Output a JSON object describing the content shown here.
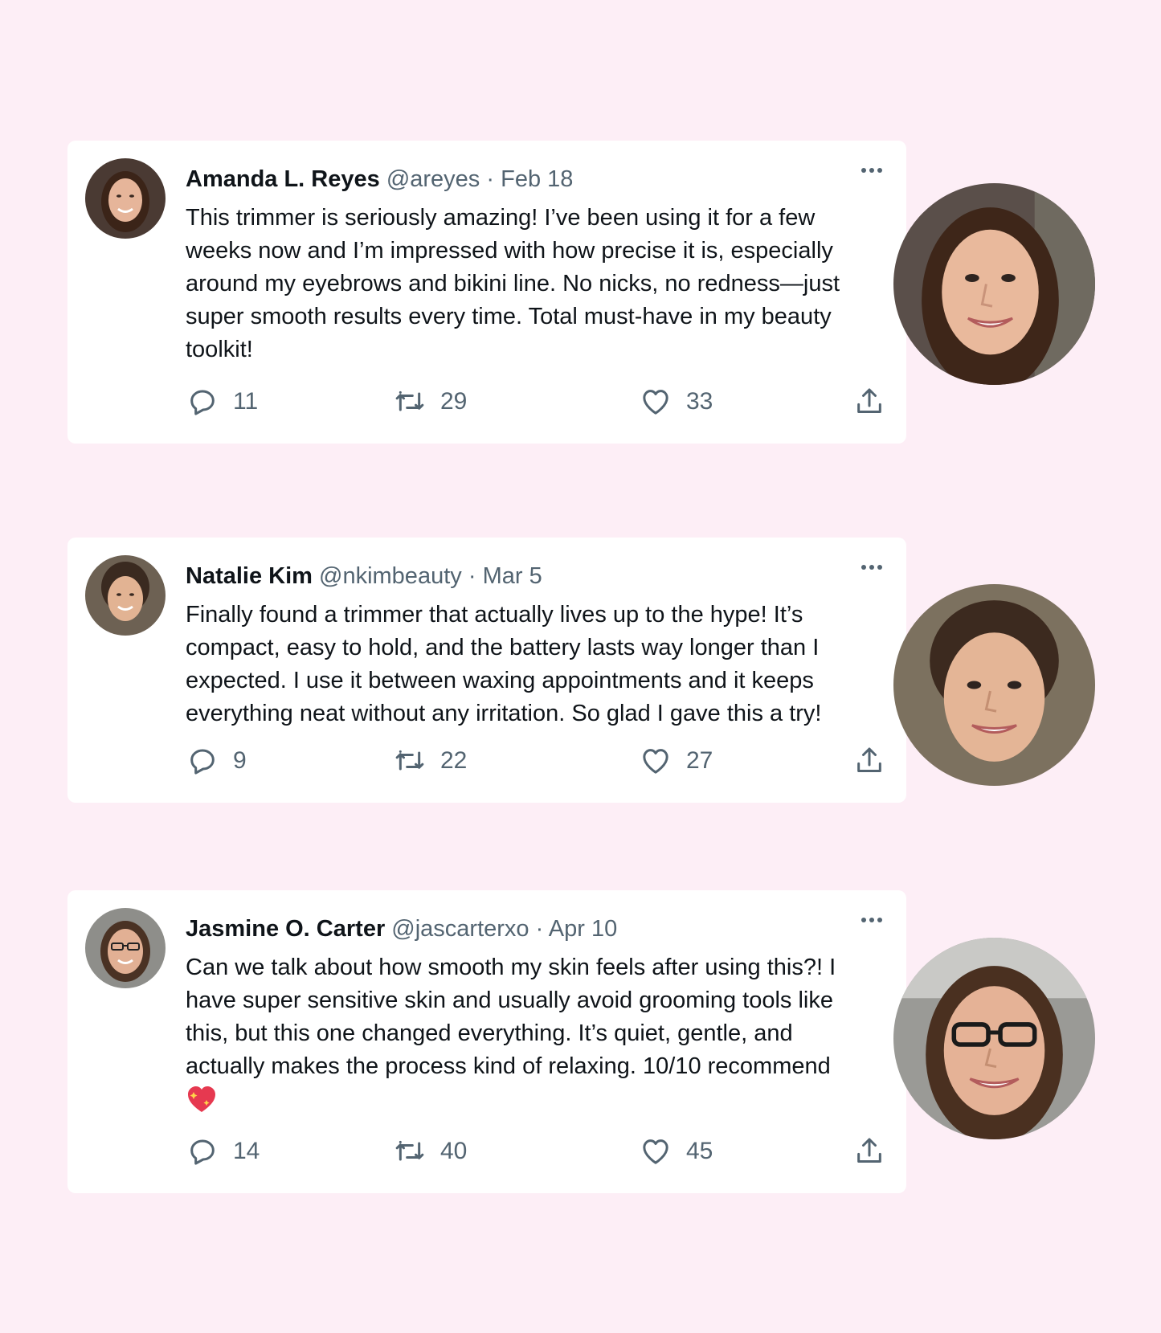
{
  "colors": {
    "background": "#fdeef6",
    "card": "#ffffff",
    "text": "#0f1419",
    "muted": "#536471"
  },
  "tweets": [
    {
      "name": "Amanda L. Reyes",
      "handle": "@areyes",
      "separator": "·",
      "date": "Feb 18",
      "text": "This trimmer is seriously amazing! I’ve been using it for a few weeks now and I’m impressed with how precise it is, especially around my eyebrows and bikini line. No nicks, no redness—just super smooth results every time. Total must-have in my beauty toolkit!",
      "replies": "11",
      "retweets": "29",
      "likes": "33",
      "icons": [
        "reply-icon",
        "retweet-icon",
        "heart-icon",
        "share-icon",
        "more-icon"
      ]
    },
    {
      "name": "Natalie Kim",
      "handle": "@nkimbeauty",
      "separator": "·",
      "date": "Mar 5",
      "text": "Finally found a trimmer that actually lives up to the hype! It’s compact, easy to hold, and the battery lasts way longer than I expected. I use it between waxing appointments and it keeps everything neat without any irritation. So glad I gave this a try!",
      "replies": "9",
      "retweets": "22",
      "likes": "27",
      "icons": [
        "reply-icon",
        "retweet-icon",
        "heart-icon",
        "share-icon",
        "more-icon"
      ]
    },
    {
      "name": "Jasmine O. Carter",
      "handle": "@jascarterxo",
      "separator": "·",
      "date": "Apr 10",
      "text": "Can we talk about how smooth my skin feels after using this?! I have super sensitive skin and usually avoid grooming tools like this, but this one changed everything. It’s quiet, gentle, and actually makes the process kind of relaxing. 10/10 recommend",
      "emoji": "sparkling-heart",
      "replies": "14",
      "retweets": "40",
      "likes": "45",
      "icons": [
        "reply-icon",
        "retweet-icon",
        "heart-icon",
        "share-icon",
        "more-icon"
      ]
    }
  ]
}
